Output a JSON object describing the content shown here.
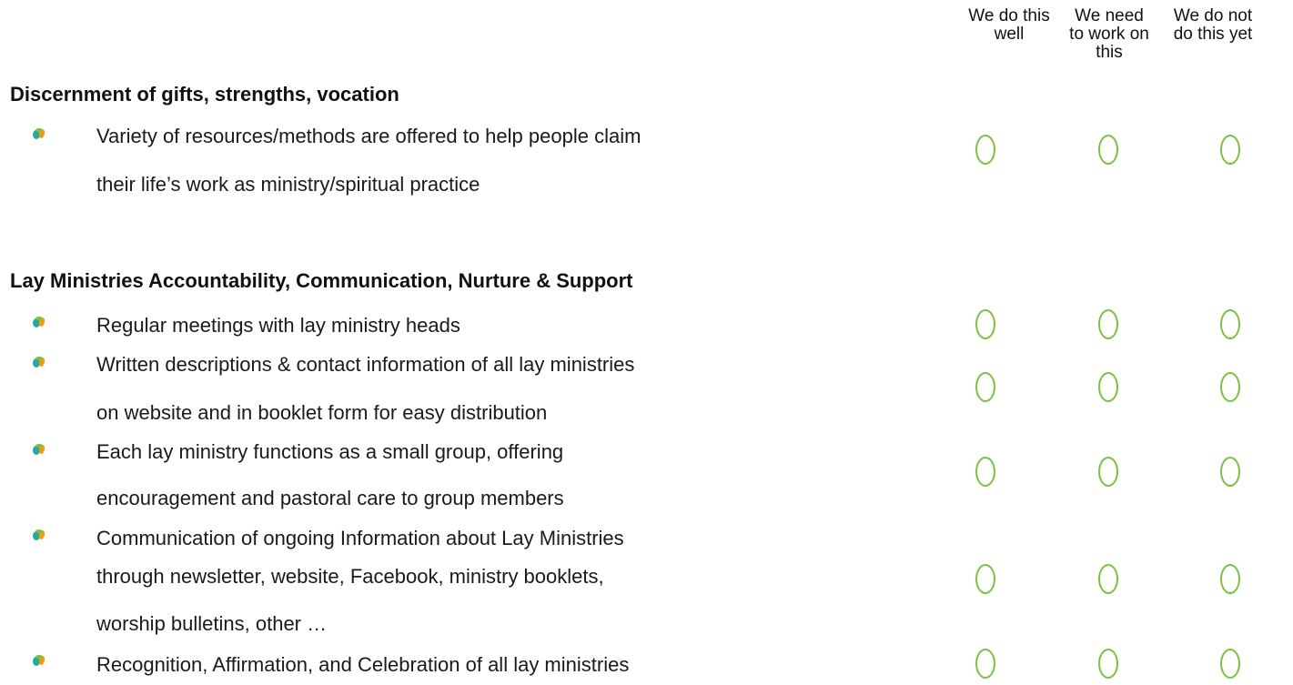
{
  "columns": [
    "We do this\nwell",
    "We need\nto work on\nthis",
    "We do not\ndo this yet"
  ],
  "sections": [
    {
      "title": "Discernment of gifts, strengths, vocation",
      "items": [
        {
          "lines": [
            "Variety of resources/methods are offered to help people claim",
            "their life’s work as ministry/spiritual practice"
          ]
        }
      ]
    },
    {
      "title": "Lay Ministries Accountability, Communication, Nurture & Support",
      "items": [
        {
          "lines": [
            "Regular meetings with lay ministry heads"
          ]
        },
        {
          "lines": [
            "Written descriptions & contact information of all lay ministries",
            "on website and in booklet form for easy distribution"
          ]
        },
        {
          "lines": [
            "Each lay ministry functions as a small group, offering",
            "encouragement and pastoral care to group members"
          ]
        },
        {
          "lines": [
            "Communication of ongoing Information about Lay Ministries",
            "through newsletter, website, Facebook, ministry booklets,",
            "worship bulletins, other …"
          ]
        },
        {
          "lines": [
            "Recognition, Affirmation, and Celebration of all lay ministries"
          ]
        }
      ]
    }
  ],
  "bullet_icon": "leaf-bullet-icon",
  "colors": {
    "radio_border": "#7ac142",
    "bullet_teal": "#2aa7a0",
    "bullet_orange": "#f39c12",
    "bullet_green": "#7ac142"
  }
}
